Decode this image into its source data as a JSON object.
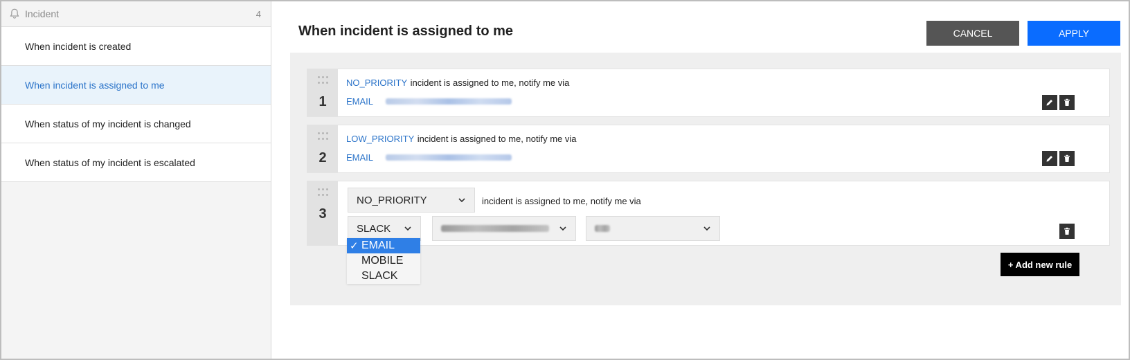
{
  "sidebar": {
    "header": {
      "icon": "bell-icon",
      "title": "Incident",
      "count": "4"
    },
    "items": [
      {
        "label": "When incident is created",
        "active": false
      },
      {
        "label": "When incident is assigned to me",
        "active": true
      },
      {
        "label": "When status of my incident is changed",
        "active": false
      },
      {
        "label": "When status of my incident is escalated",
        "active": false
      }
    ]
  },
  "main": {
    "title": "When incident is assigned to me",
    "cancel_label": "CANCEL",
    "apply_label": "APPLY",
    "rules": [
      {
        "number": "1",
        "priority": "NO_PRIORITY",
        "text": "incident is assigned to me, notify me via",
        "channel": "EMAIL"
      },
      {
        "number": "2",
        "priority": "LOW_PRIORITY",
        "text": "incident is assigned to me, notify me via",
        "channel": "EMAIL"
      }
    ],
    "editing_rule": {
      "number": "3",
      "priority_select": "NO_PRIORITY",
      "text": "incident is assigned to me, notify me via",
      "channel_select": "SLACK",
      "channel_options": [
        "EMAIL",
        "MOBILE",
        "SLACK"
      ],
      "checked_option": "EMAIL",
      "check_mark": "✓"
    },
    "add_rule_label": "+ Add new rule"
  },
  "colors": {
    "accent": "#0a6cff",
    "link": "#2a73c9",
    "cancel": "#555555",
    "active_item_bg": "#e9f3fb"
  }
}
